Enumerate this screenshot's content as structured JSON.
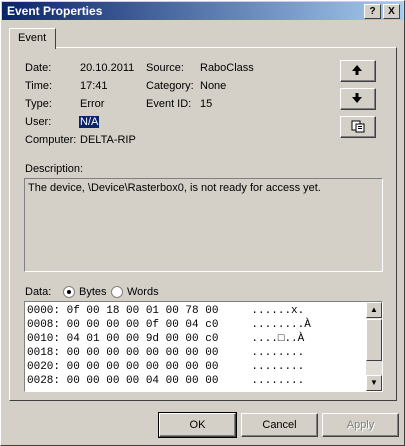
{
  "window": {
    "title": "Event Properties",
    "help_label": "?",
    "close_label": "X"
  },
  "tabs": [
    {
      "label": "Event"
    }
  ],
  "fields": {
    "date_label": "Date:",
    "date": "20.10.2011",
    "time_label": "Time:",
    "time": "17:41",
    "type_label": "Type:",
    "type": "Error",
    "user_label": "User:",
    "user": "N/A",
    "computer_label": "Computer:",
    "computer": "DELTA-RIP",
    "source_label": "Source:",
    "source": "RaboClass",
    "category_label": "Category:",
    "category": "None",
    "eventid_label": "Event ID:",
    "eventid": "15"
  },
  "description": {
    "label": "Description:",
    "text": "The device, \\Device\\Rasterbox0, is not ready for access yet."
  },
  "data": {
    "label": "Data:",
    "bytes_label": "Bytes",
    "words_label": "Words",
    "selected": "Bytes",
    "lines": [
      "0000: 0f 00 18 00 01 00 78 00     ......x.",
      "0008: 00 00 00 00 0f 00 04 c0     ........À",
      "0010: 04 01 00 00 9d 00 00 c0     ....□..À",
      "0018: 00 00 00 00 00 00 00 00     ........",
      "0020: 00 00 00 00 00 00 00 00     ........",
      "0028: 00 00 00 00 04 00 00 00     ........"
    ]
  },
  "buttons": {
    "ok": "OK",
    "cancel": "Cancel",
    "apply": "Apply"
  },
  "icons": {
    "up": "arrow-up-icon",
    "down": "arrow-down-icon",
    "copy": "copy-icon"
  }
}
